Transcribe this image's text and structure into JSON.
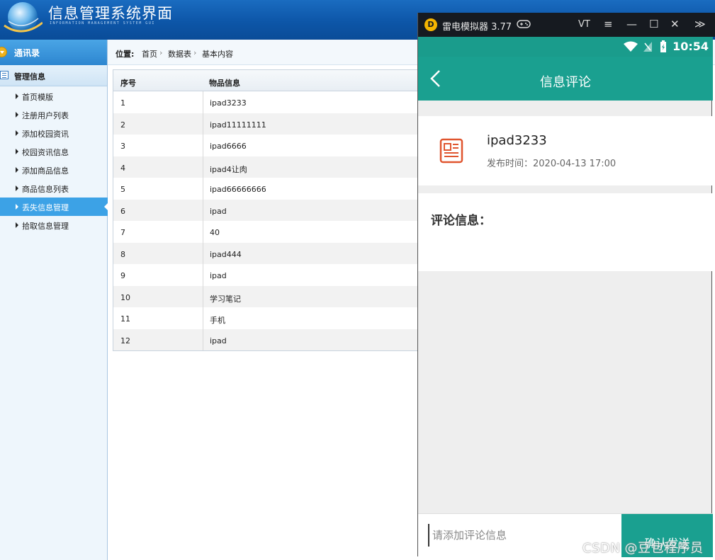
{
  "header": {
    "title": "信息管理系统界面",
    "subtitle": "INFORMATION MANAGEMENT SYSTEM GUI"
  },
  "sidebar": {
    "group_contacts": "通讯录",
    "group_manage": "管理信息",
    "items": [
      {
        "label": "首页模版"
      },
      {
        "label": "注册用户列表"
      },
      {
        "label": "添加校园资讯"
      },
      {
        "label": "校园资讯信息"
      },
      {
        "label": "添加商品信息"
      },
      {
        "label": "商品信息列表"
      },
      {
        "label": "丢失信息管理",
        "active": true
      },
      {
        "label": "拾取信息管理"
      }
    ]
  },
  "breadcrumb": {
    "prefix": "位置:",
    "items": [
      "首页",
      "数据表",
      "基本内容"
    ]
  },
  "table": {
    "columns": [
      "序号",
      "物品信息"
    ],
    "rows": [
      [
        "1",
        "ipad3233"
      ],
      [
        "2",
        "ipad11111111"
      ],
      [
        "3",
        "ipad6666"
      ],
      [
        "4",
        "ipad4让肉"
      ],
      [
        "5",
        "ipad66666666"
      ],
      [
        "6",
        "ipad"
      ],
      [
        "7",
        "40"
      ],
      [
        "8",
        "ipad444"
      ],
      [
        "9",
        "ipad"
      ],
      [
        "10",
        "学习笔记"
      ],
      [
        "11",
        "手机"
      ],
      [
        "12",
        "ipad"
      ]
    ]
  },
  "emulator": {
    "title": "雷电模拟器 3.77",
    "controls": [
      "VT",
      "≡",
      "—",
      "☐",
      "✕",
      "≫"
    ],
    "status_time": "10:54",
    "app": {
      "header_title": "信息评论",
      "item_title": "ipad3233",
      "item_time": "发布时间：2020-04-13 17:00",
      "comment_label": "评论信息：",
      "input_placeholder": "请添加评论信息",
      "send_label": "确认发送"
    }
  },
  "watermark": "CSDN @豆包程序员",
  "colors": {
    "header_blue": "#0d56a8",
    "active_nav": "#3ca2e6",
    "app_teal": "#1aa090"
  }
}
